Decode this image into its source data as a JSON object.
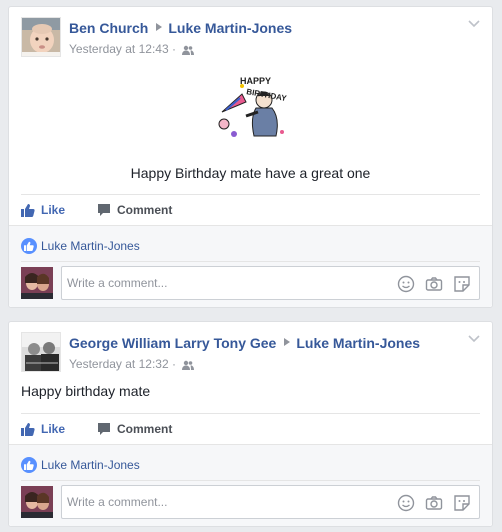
{
  "posts": [
    {
      "author": "Ben Church",
      "recipient": "Luke Martin-Jones",
      "timestamp": "Yesterday at 12:43",
      "privacy_icon": "friends-icon",
      "text": "Happy Birthday mate have a great one",
      "image": {
        "icon": "happy-birthday-clipart",
        "text_line1": "HAPPY",
        "text_line2": "BIRTHDAY"
      },
      "actions": {
        "like_label": "Like",
        "comment_label": "Comment"
      },
      "likes": {
        "names": "Luke Martin-Jones"
      },
      "comment_input": {
        "placeholder": "Write a comment..."
      }
    },
    {
      "author": "George William Larry Tony Gee",
      "recipient": "Luke Martin-Jones",
      "timestamp": "Yesterday at 12:32",
      "privacy_icon": "friends-icon",
      "text": "Happy birthday mate",
      "actions": {
        "like_label": "Like",
        "comment_label": "Comment"
      },
      "likes": {
        "names": "Luke Martin-Jones"
      },
      "comment_input": {
        "placeholder": "Write a comment..."
      }
    }
  ],
  "colors": {
    "page_bg": "#e9ebee",
    "link_blue": "#365899",
    "like_blue": "#4267b2",
    "meta_gray": "#90949c"
  }
}
